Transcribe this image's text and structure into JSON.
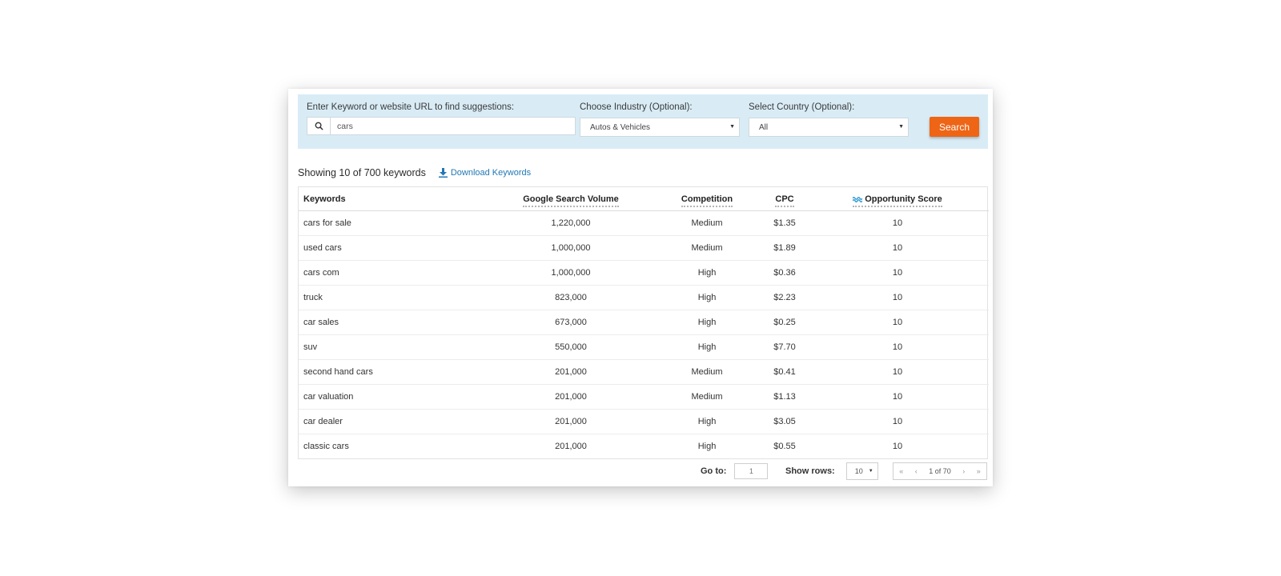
{
  "search": {
    "keyword_label": "Enter Keyword or website URL to find suggestions:",
    "keyword_value": "cars",
    "industry_label": "Choose Industry (Optional):",
    "industry_value": "Autos & Vehicles",
    "country_label": "Select Country (Optional):",
    "country_value": "All",
    "search_button": "Search"
  },
  "summary": {
    "showing_text": "Showing 10 of 700 keywords",
    "download_label": "Download Keywords"
  },
  "table": {
    "headers": {
      "keywords": "Keywords",
      "volume": "Google Search Volume",
      "competition": "Competition",
      "cpc": "CPC",
      "opportunity": "Opportunity Score"
    },
    "rows": [
      {
        "keyword": "cars for sale",
        "volume": "1,220,000",
        "competition": "Medium",
        "cpc": "$1.35",
        "score": "10"
      },
      {
        "keyword": "used cars",
        "volume": "1,000,000",
        "competition": "Medium",
        "cpc": "$1.89",
        "score": "10"
      },
      {
        "keyword": "cars com",
        "volume": "1,000,000",
        "competition": "High",
        "cpc": "$0.36",
        "score": "10"
      },
      {
        "keyword": "truck",
        "volume": "823,000",
        "competition": "High",
        "cpc": "$2.23",
        "score": "10"
      },
      {
        "keyword": "car sales",
        "volume": "673,000",
        "competition": "High",
        "cpc": "$0.25",
        "score": "10"
      },
      {
        "keyword": "suv",
        "volume": "550,000",
        "competition": "High",
        "cpc": "$7.70",
        "score": "10"
      },
      {
        "keyword": "second hand cars",
        "volume": "201,000",
        "competition": "Medium",
        "cpc": "$0.41",
        "score": "10"
      },
      {
        "keyword": "car valuation",
        "volume": "201,000",
        "competition": "Medium",
        "cpc": "$1.13",
        "score": "10"
      },
      {
        "keyword": "car dealer",
        "volume": "201,000",
        "competition": "High",
        "cpc": "$3.05",
        "score": "10"
      },
      {
        "keyword": "classic cars",
        "volume": "201,000",
        "competition": "High",
        "cpc": "$0.55",
        "score": "10"
      }
    ]
  },
  "pagination": {
    "goto_label": "Go to:",
    "goto_value": "1",
    "rows_label": "Show rows:",
    "rows_value": "10",
    "first": "«",
    "prev": "‹",
    "page_info": "1 of 70",
    "next": "›",
    "last": "»"
  },
  "colors": {
    "panel_bg": "#d9ecf6",
    "search_button": "#ee6516",
    "link": "#1f78b4",
    "opportunity_icon": "#3a9fd6"
  },
  "icons": {
    "search": "search-icon",
    "download": "download-icon",
    "opportunity": "wave-icon",
    "dropdown": "caret-down-icon"
  }
}
